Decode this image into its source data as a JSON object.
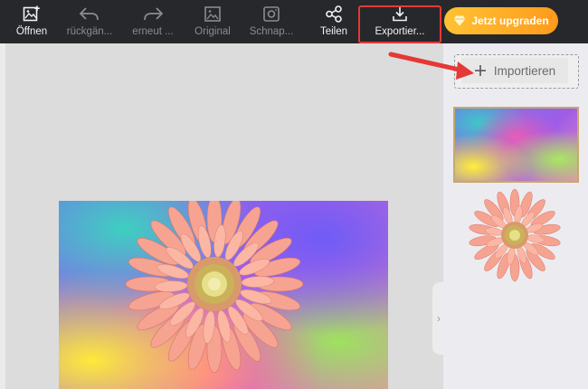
{
  "toolbar": {
    "open_label": "Öffnen",
    "undo_label": "rückgän...",
    "redo_label": "erneut ...",
    "original_label": "Original",
    "snapshot_label": "Schnap...",
    "share_label": "Teilen",
    "export_label": "Exportier...",
    "upgrade_label": "Jetzt upgraden"
  },
  "right_panel": {
    "import_label": "Importieren",
    "thumbnails": [
      "background-thumbnail",
      "flower-thumbnail"
    ]
  },
  "colors": {
    "toolbar_bg": "#26282c",
    "highlight": "#e53935",
    "upgrade_start": "#ffc233",
    "upgrade_end": "#ff9a1c",
    "selected_thumb_border": "#c7a96a"
  },
  "icons": {
    "open": "image-plus-icon",
    "undo": "undo-arrow-icon",
    "redo": "redo-arrow-icon",
    "original": "image-icon",
    "snapshot": "camera-icon",
    "share": "share-nodes-icon",
    "export": "download-icon",
    "upgrade": "diamond-icon",
    "import": "plus-icon",
    "collapse": "chevron-right-icon"
  }
}
